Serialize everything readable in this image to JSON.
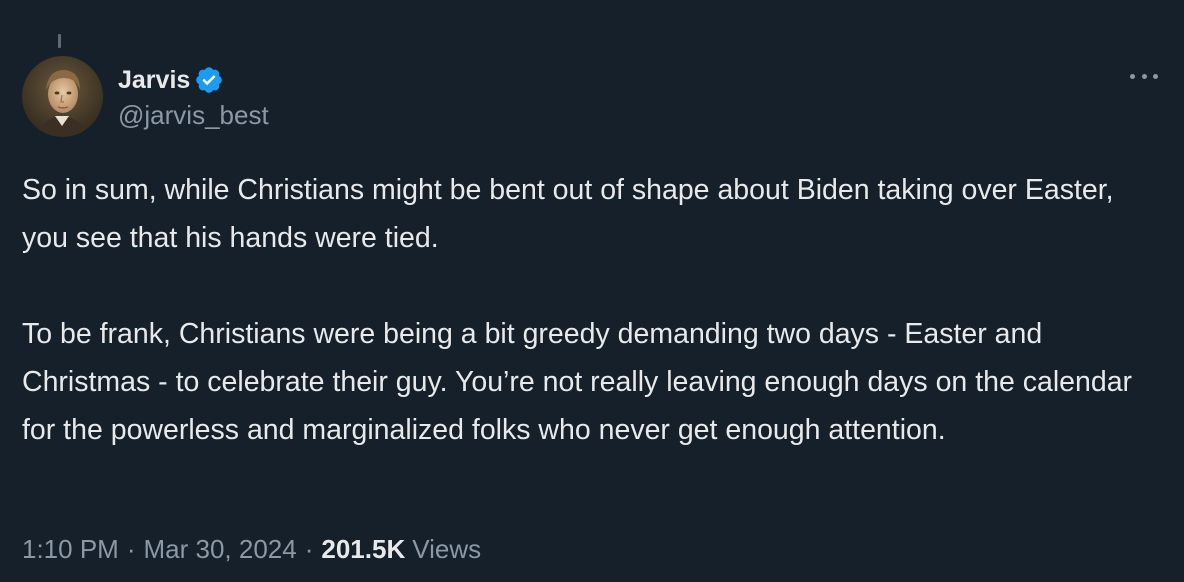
{
  "author": {
    "display_name": "Jarvis",
    "handle": "@jarvis_best",
    "verified": true,
    "verified_color": "#1d9bf0"
  },
  "tweet": {
    "paragraphs": [
      "So in sum, while Christians might be bent out of shape about Biden taking over Easter, you see that his hands were tied.",
      "To be frank, Christians were being a bit greedy demanding two days - Easter and Christmas - to celebrate their guy. You’re not really leaving enough days on the calendar for the powerless and marginalized folks who never get enough attention."
    ],
    "time": "1:10 PM",
    "separator": "·",
    "date": "Mar 30, 2024",
    "views_count": "201.5K",
    "views_label": "Views"
  },
  "icons": {
    "more": "more-options-icon",
    "verified": "verified-badge-icon",
    "avatar": "avatar"
  },
  "colors": {
    "background": "#15202b",
    "text_primary": "#e7e9ea",
    "text_secondary": "#8b98a5"
  }
}
